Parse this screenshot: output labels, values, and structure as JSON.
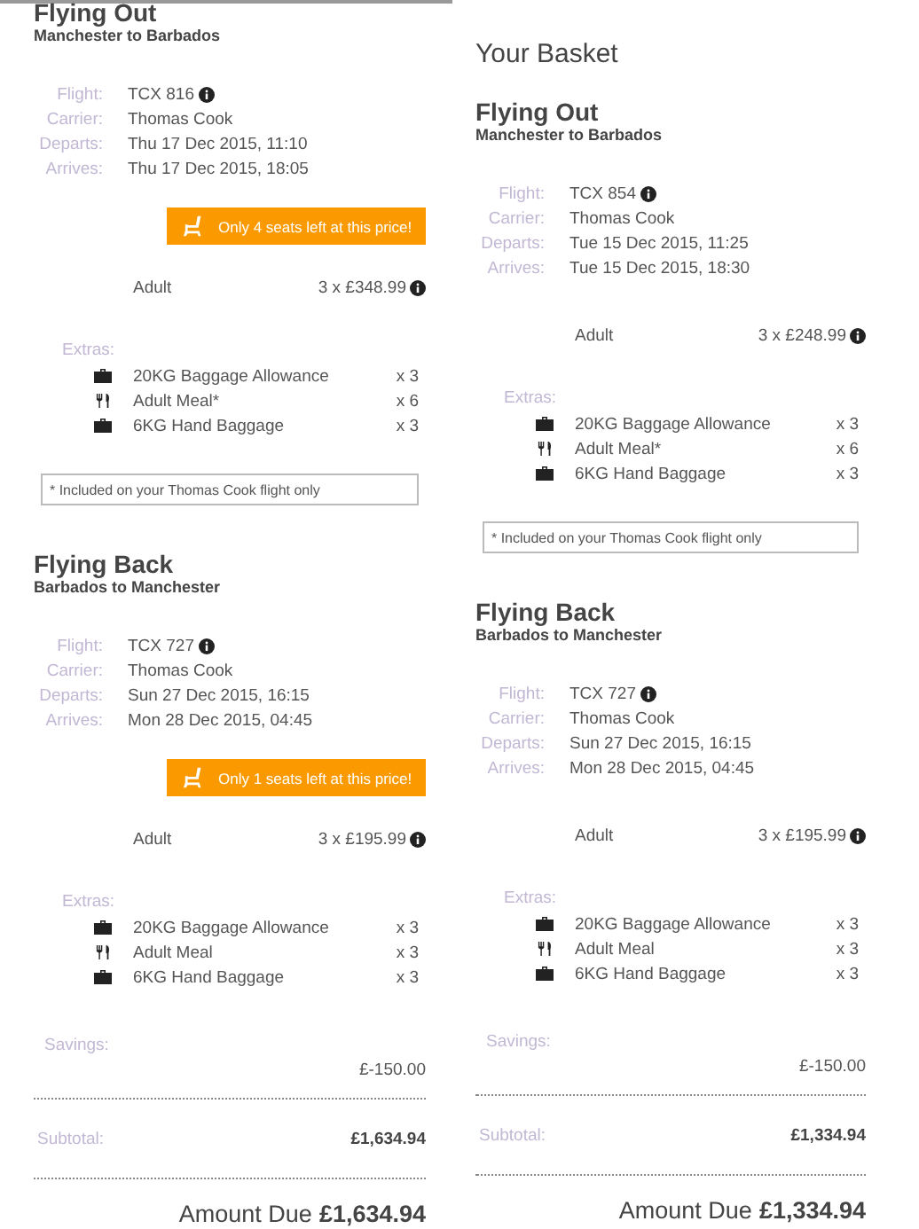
{
  "columns": [
    {
      "legs": [
        {
          "title": "Flying Out",
          "route": "Manchester to Barbados",
          "details": [
            {
              "label": "Flight:",
              "value": "TCX 816",
              "info": true
            },
            {
              "label": "Carrier:",
              "value": "Thomas Cook",
              "info": false
            },
            {
              "label": "Departs:",
              "value": "Thu 17 Dec 2015, 11:10",
              "info": false
            },
            {
              "label": "Arrives:",
              "value": "Thu 17 Dec 2015, 18:05",
              "info": false
            }
          ],
          "alert": "Only 4 seats left at this price!",
          "fare": {
            "label": "Adult",
            "price": "3 x £348.99"
          },
          "extras_label": "Extras:",
          "extras": [
            {
              "kind": "bag",
              "name": "20KG Baggage Allowance",
              "qty": "x 3"
            },
            {
              "kind": "meal",
              "name": "Adult Meal*",
              "qty": "x 6"
            },
            {
              "kind": "bag",
              "name": "6KG Hand Baggage",
              "qty": "x 3"
            }
          ],
          "note": "* Included on your Thomas Cook flight only"
        },
        {
          "title": "Flying Back",
          "route": "Barbados to Manchester",
          "details": [
            {
              "label": "Flight:",
              "value": "TCX 727",
              "info": true
            },
            {
              "label": "Carrier:",
              "value": "Thomas Cook",
              "info": false
            },
            {
              "label": "Departs:",
              "value": "Sun 27 Dec 2015, 16:15",
              "info": false
            },
            {
              "label": "Arrives:",
              "value": "Mon 28 Dec 2015, 04:45",
              "info": false
            }
          ],
          "alert": "Only 1 seats left at this price!",
          "fare": {
            "label": "Adult",
            "price": "3 x £195.99"
          },
          "extras_label": "Extras:",
          "extras": [
            {
              "kind": "bag",
              "name": "20KG Baggage Allowance",
              "qty": "x 3"
            },
            {
              "kind": "meal",
              "name": "Adult Meal",
              "qty": "x 3"
            },
            {
              "kind": "bag",
              "name": "6KG Hand Baggage",
              "qty": "x 3"
            }
          ]
        }
      ],
      "savings": {
        "label": "Savings:",
        "value": "£-150.00"
      },
      "subtotal": {
        "label": "Subtotal:",
        "value": "£1,634.94"
      },
      "amount_due": {
        "label": "Amount Due",
        "value": "£1,634.94"
      }
    },
    {
      "heading": "Your Basket",
      "legs": [
        {
          "title": "Flying Out",
          "route": "Manchester to Barbados",
          "details": [
            {
              "label": "Flight:",
              "value": "TCX 854",
              "info": true
            },
            {
              "label": "Carrier:",
              "value": "Thomas Cook",
              "info": false
            },
            {
              "label": "Departs:",
              "value": "Tue 15 Dec 2015, 11:25",
              "info": false
            },
            {
              "label": "Arrives:",
              "value": "Tue 15 Dec 2015, 18:30",
              "info": false
            }
          ],
          "fare": {
            "label": "Adult",
            "price": "3 x £248.99"
          },
          "extras_label": "Extras:",
          "extras": [
            {
              "kind": "bag",
              "name": "20KG Baggage Allowance",
              "qty": "x 3"
            },
            {
              "kind": "meal",
              "name": "Adult Meal*",
              "qty": "x 6"
            },
            {
              "kind": "bag",
              "name": "6KG Hand Baggage",
              "qty": "x 3"
            }
          ],
          "note": "* Included on your Thomas Cook flight only"
        },
        {
          "title": "Flying Back",
          "route": "Barbados to Manchester",
          "details": [
            {
              "label": "Flight:",
              "value": "TCX 727",
              "info": true
            },
            {
              "label": "Carrier:",
              "value": "Thomas Cook",
              "info": false
            },
            {
              "label": "Departs:",
              "value": "Sun 27 Dec 2015, 16:15",
              "info": false
            },
            {
              "label": "Arrives:",
              "value": "Mon 28 Dec 2015, 04:45",
              "info": false
            }
          ],
          "fare": {
            "label": "Adult",
            "price": "3 x £195.99"
          },
          "extras_label": "Extras:",
          "extras": [
            {
              "kind": "bag",
              "name": "20KG Baggage Allowance",
              "qty": "x 3"
            },
            {
              "kind": "meal",
              "name": "Adult Meal",
              "qty": "x 3"
            },
            {
              "kind": "bag",
              "name": "6KG Hand Baggage",
              "qty": "x 3"
            }
          ]
        }
      ],
      "savings": {
        "label": "Savings:",
        "value": "£-150.00"
      },
      "subtotal": {
        "label": "Subtotal:",
        "value": "£1,334.94"
      },
      "amount_due": {
        "label": "Amount Due",
        "value": "£1,334.94"
      }
    }
  ]
}
